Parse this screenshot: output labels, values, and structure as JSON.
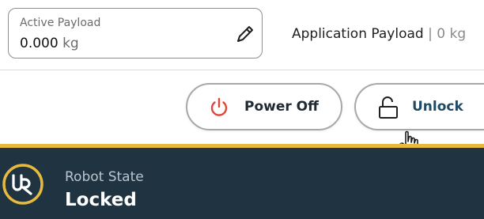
{
  "payload": {
    "label": "Active Payload",
    "value": "0.000",
    "unit": "kg",
    "edit_icon": "pencil-icon"
  },
  "application_payload": {
    "label": "Application Payload",
    "separator": "|",
    "value": "0 kg"
  },
  "actions": {
    "power_off": {
      "label": "Power Off",
      "icon": "power-icon",
      "icon_color": "#e0473a"
    },
    "unlock": {
      "label": "Unlock",
      "icon": "unlock-icon"
    }
  },
  "robot_state": {
    "label": "Robot State",
    "value": "Locked",
    "logo": "ur-logo"
  },
  "colors": {
    "status_bar_bg": "#1f3440",
    "accent_gold": "#e7b93f",
    "unlock_text": "#1f4a63"
  }
}
